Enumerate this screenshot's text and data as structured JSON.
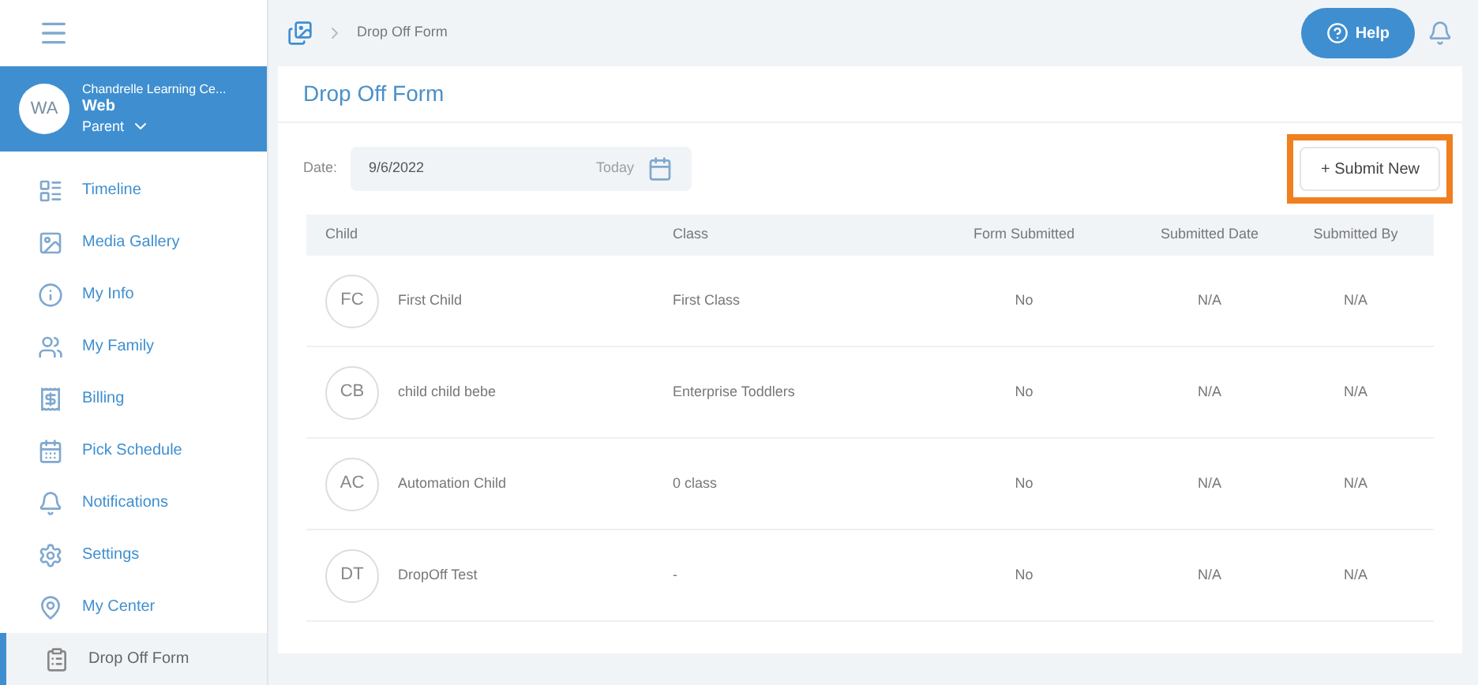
{
  "breadcrumb": {
    "current": "Drop Off Form"
  },
  "help_button": {
    "label": "Help"
  },
  "profile": {
    "initials": "WA",
    "organization": "Chandrelle Learning Ce...",
    "name": "Web",
    "role": "Parent"
  },
  "sidebar": {
    "items": [
      {
        "kind": "timeline",
        "label": "Timeline",
        "selected": false
      },
      {
        "kind": "media",
        "label": "Media Gallery",
        "selected": false
      },
      {
        "kind": "info",
        "label": "My Info",
        "selected": false
      },
      {
        "kind": "family",
        "label": "My Family",
        "selected": false
      },
      {
        "kind": "billing",
        "label": "Billing",
        "selected": false
      },
      {
        "kind": "schedule",
        "label": "Pick Schedule",
        "selected": false
      },
      {
        "kind": "notifications",
        "label": "Notifications",
        "selected": false
      },
      {
        "kind": "settings",
        "label": "Settings",
        "selected": false
      },
      {
        "kind": "center",
        "label": "My Center",
        "selected": false
      },
      {
        "kind": "dropoff",
        "label": "Drop Off Form",
        "selected": true
      }
    ]
  },
  "page_title": "Drop Off Form",
  "date_field": {
    "label": "Date:",
    "value": "9/6/2022",
    "today": "Today"
  },
  "submit_button": {
    "label": "+ Submit New",
    "highlighted": true
  },
  "table": {
    "columns": [
      "Child",
      "Class",
      "Form Submitted",
      "Submitted Date",
      "Submitted By"
    ],
    "rows": [
      {
        "initials": "FC",
        "child": "First Child",
        "class": "First Class",
        "form_submitted": "No",
        "submitted_date": "N/A",
        "submitted_by": "N/A"
      },
      {
        "initials": "CB",
        "child": "child child bebe",
        "class": "Enterprise Toddlers",
        "form_submitted": "No",
        "submitted_date": "N/A",
        "submitted_by": "N/A"
      },
      {
        "initials": "AC",
        "child": "Automation Child",
        "class": "0 class",
        "form_submitted": "No",
        "submitted_date": "N/A",
        "submitted_by": "N/A"
      },
      {
        "initials": "DT",
        "child": "DropOff Test",
        "class": "-",
        "form_submitted": "No",
        "submitted_date": "N/A",
        "submitted_by": "N/A"
      }
    ]
  }
}
